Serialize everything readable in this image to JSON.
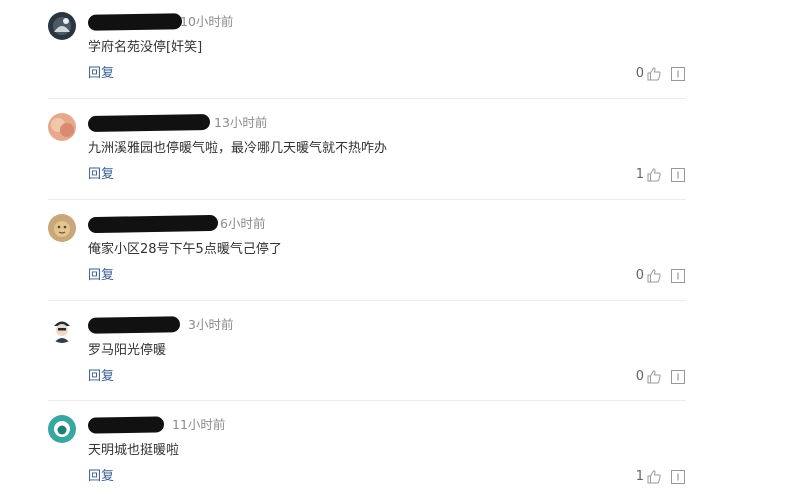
{
  "comments": [
    {
      "time": "10小时前",
      "text": "学府名苑没停[奸笑]",
      "reply": "回复",
      "likes": "0",
      "avatar_color": "#2b3540"
    },
    {
      "time": "13小时前",
      "text": "九洲溪雅园也停暖气啦，最冷哪几天暖气就不热咋办",
      "reply": "回复",
      "likes": "1",
      "avatar_color": "#e7a88c"
    },
    {
      "time": "6小时前",
      "text": "俺家小区28号下午5点暖气己停了",
      "reply": "回复",
      "likes": "0",
      "avatar_color": "#c9a77a"
    },
    {
      "time": "3小时前",
      "text": "罗马阳光停暖",
      "reply": "回复",
      "likes": "0",
      "avatar_color": "#1f2c3a"
    },
    {
      "time": "11小时前",
      "text": "天明城也挺暖啦",
      "reply": "回复",
      "likes": "1",
      "avatar_color": "#3aa6a0"
    }
  ],
  "icons": {
    "like": "thumbs-up-icon",
    "report": "report-flag-icon"
  }
}
